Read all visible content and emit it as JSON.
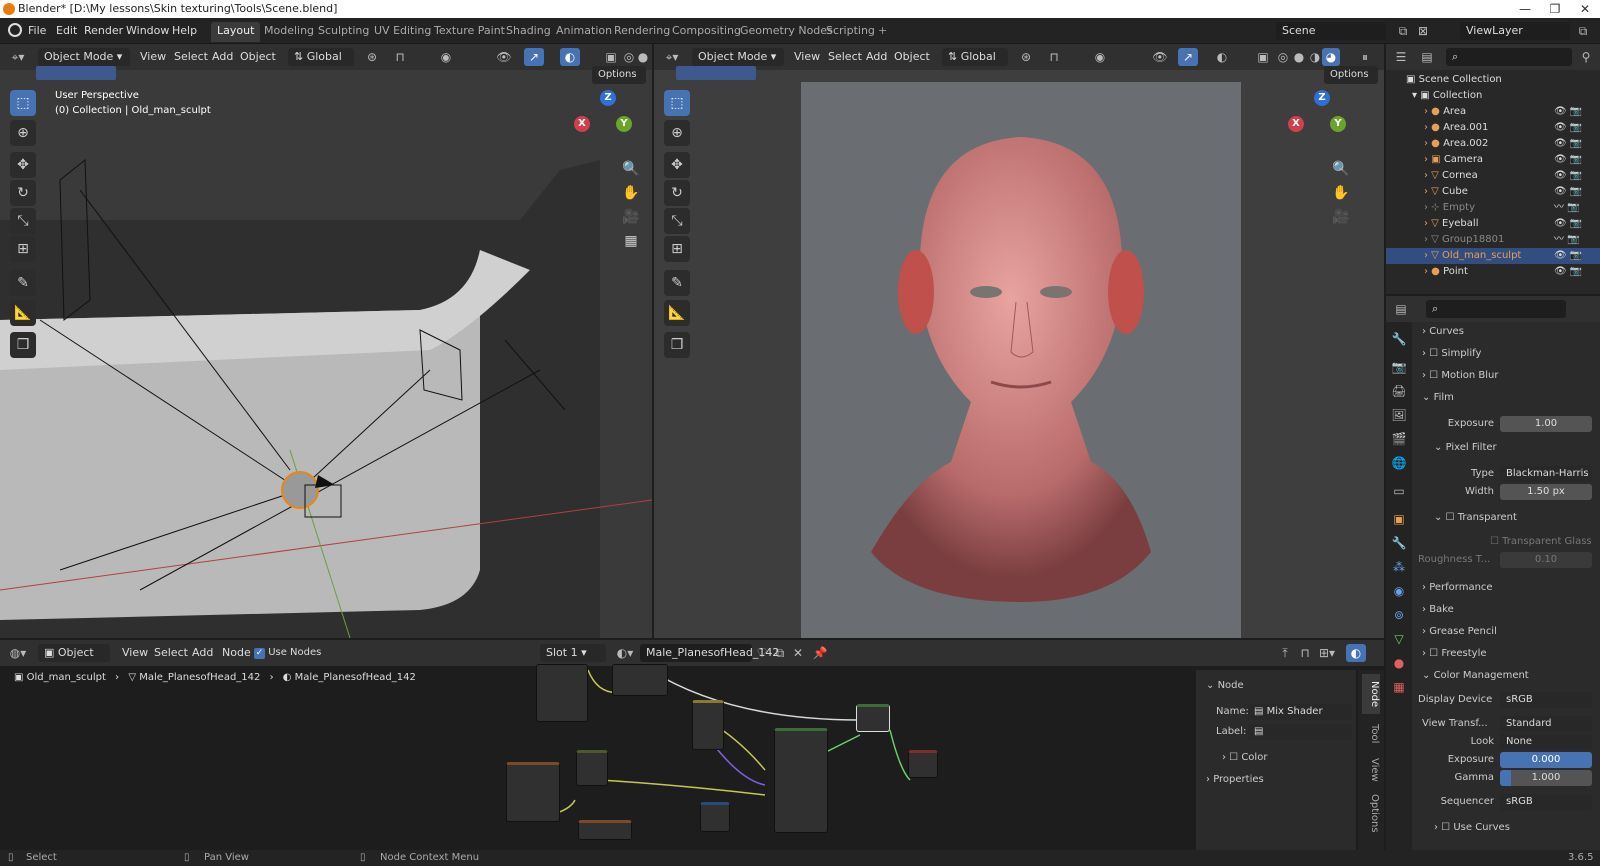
{
  "window": {
    "title": "Blender* [D:\\My lessons\\Skin texturing\\Tools\\Scene.blend]"
  },
  "menus": [
    "File",
    "Edit",
    "Render",
    "Window",
    "Help"
  ],
  "workspaces": [
    "Layout",
    "Modeling",
    "Sculpting",
    "UV Editing",
    "Texture Paint",
    "Shading",
    "Animation",
    "Rendering",
    "Compositing",
    "Geometry Nodes",
    "Scripting"
  ],
  "active_workspace": "Layout",
  "scene": {
    "label": "Scene",
    "view_layer": "ViewLayer"
  },
  "viewport_left": {
    "mode": "Object Mode",
    "menus": [
      "View",
      "Select",
      "Add",
      "Object"
    ],
    "orientation": "Global",
    "options": "Options",
    "overlay_title": "User Perspective",
    "overlay_subtitle": "(0) Collection | Old_man_sculpt"
  },
  "viewport_right": {
    "mode": "Object Mode",
    "menus": [
      "View",
      "Select",
      "Add",
      "Object"
    ],
    "orientation": "Global",
    "options": "Options"
  },
  "gizmo": {
    "x": "X",
    "y": "Y",
    "z": "Z"
  },
  "outliner": {
    "root": "Scene Collection",
    "collection": "Collection",
    "items": [
      {
        "name": "Area",
        "state": "normal"
      },
      {
        "name": "Area.001",
        "state": "normal"
      },
      {
        "name": "Area.002",
        "state": "normal"
      },
      {
        "name": "Camera",
        "state": "normal"
      },
      {
        "name": "Cornea",
        "state": "normal"
      },
      {
        "name": "Cube",
        "state": "normal"
      },
      {
        "name": "Empty",
        "state": "dim"
      },
      {
        "name": "Eyeball",
        "state": "normal"
      },
      {
        "name": "Group18801",
        "state": "dim"
      },
      {
        "name": "Old_man_sculpt",
        "state": "selected"
      },
      {
        "name": "Point",
        "state": "normal"
      }
    ]
  },
  "properties": {
    "curves": "Curves",
    "simplify": "Simplify",
    "motion_blur": "Motion Blur",
    "film": "Film",
    "exposure_label": "Exposure",
    "exposure_value": "1.00",
    "pixel_filter": "Pixel Filter",
    "type_label": "Type",
    "type_value": "Blackman-Harris",
    "width_label": "Width",
    "width_value": "1.50 px",
    "transparent": "Transparent",
    "transparent_glass": "Transparent Glass",
    "roughness_label": "Roughness T...",
    "roughness_value": "0.10",
    "performance": "Performance",
    "bake": "Bake",
    "grease_pencil": "Grease Pencil",
    "freestyle": "Freestyle",
    "color_management": "Color Management",
    "display_device_label": "Display Device",
    "display_device_value": "sRGB",
    "view_transform_label": "View Transf...",
    "view_transform_value": "Standard",
    "look_label": "Look",
    "look_value": "None",
    "cm_exposure_label": "Exposure",
    "cm_exposure_value": "0.000",
    "gamma_label": "Gamma",
    "gamma_value": "1.000",
    "sequencer_label": "Sequencer",
    "sequencer_value": "sRGB",
    "use_curves": "Use Curves"
  },
  "node_editor": {
    "type": "Object",
    "menus": [
      "View",
      "Select",
      "Add",
      "Node"
    ],
    "use_nodes": "Use Nodes",
    "slot": "Slot 1",
    "material": "Male_PlanesofHead_142",
    "breadcrumb": [
      "Old_man_sculpt",
      "Male_PlanesofHead_142",
      "Male_PlanesofHead_142"
    ]
  },
  "node_panel": {
    "header": "Node",
    "name_label": "Name:",
    "name_value": "Mix Shader",
    "label_label": "Label:",
    "color": "Color",
    "properties": "Properties",
    "tabs": [
      "Node",
      "Tool",
      "View",
      "Options"
    ]
  },
  "status": {
    "select": "Select",
    "pan": "Pan View",
    "context": "Node Context Menu",
    "version": "3.6.5"
  }
}
